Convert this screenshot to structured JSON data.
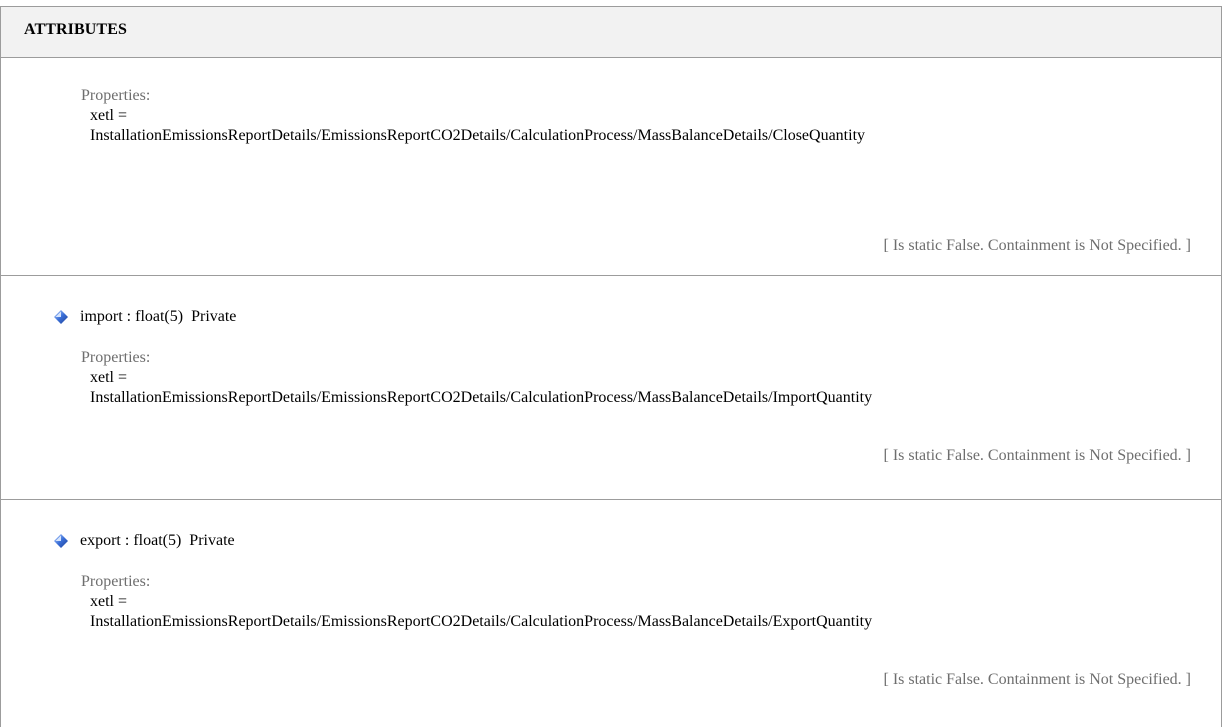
{
  "header": {
    "title": "ATTRIBUTES"
  },
  "attributes": [
    {
      "name": "",
      "properties_label": "Properties:",
      "xetl_label": "xetl =",
      "xetl_value": "InstallationEmissionsReportDetails/EmissionsReportCO2Details/CalculationProcess/MassBalanceDetails/CloseQuantity",
      "note": "[ Is static False. Containment is Not Specified. ]"
    },
    {
      "name": "import : float(5)  Private",
      "icon": "attribute-diamond-icon",
      "properties_label": "Properties:",
      "xetl_label": "xetl =",
      "xetl_value": "InstallationEmissionsReportDetails/EmissionsReportCO2Details/CalculationProcess/MassBalanceDetails/ImportQuantity",
      "note": "[ Is static False. Containment is Not Specified. ]"
    },
    {
      "name": "export : float(5)  Private",
      "icon": "attribute-diamond-icon",
      "properties_label": "Properties:",
      "xetl_label": "xetl =",
      "xetl_value": "InstallationEmissionsReportDetails/EmissionsReportCO2Details/CalculationProcess/MassBalanceDetails/ExportQuantity",
      "note": "[ Is static False. Containment is Not Specified. ]"
    }
  ],
  "colors": {
    "border": "#9c9c9c",
    "header_bg": "#f2f2f2",
    "muted_text": "#6e6e6e",
    "icon_blue": "#3a6fd8"
  }
}
